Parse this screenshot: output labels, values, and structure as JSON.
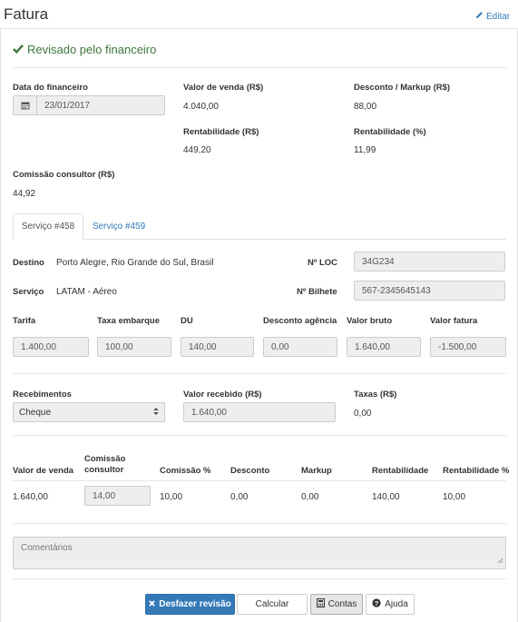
{
  "header": {
    "title": "Fatura",
    "edit_label": "Editar"
  },
  "status": {
    "text": "Revisado pelo financeiro",
    "color": "#3c763d"
  },
  "summary": {
    "date_label": "Data do financeiro",
    "date_value": "23/01/2017",
    "sale_label": "Valor de venda (R$)",
    "sale_value": "4.040,00",
    "discount_label": "Desconto / Markup (R$)",
    "discount_value": "88,00",
    "profit_label": "Rentabilidade (R$)",
    "profit_value": "449,20",
    "profit_pct_label": "Rentabilidade (%)",
    "profit_pct_value": "11,99",
    "commission_label": "Comissão consultor (R$)",
    "commission_value": "44,92"
  },
  "tabs": [
    {
      "label": "Serviço #458",
      "active": true
    },
    {
      "label": "Serviço #459",
      "active": false
    }
  ],
  "service": {
    "destination_label": "Destino",
    "destination_value": "Porto Alegre, Rio Grande do Sul, Brasil",
    "loc_label": "Nº LOC",
    "loc_value": "34G234",
    "service_label": "Serviço",
    "service_value": "LATAM - Aéreo",
    "ticket_label": "Nº Bilhete",
    "ticket_value": "567-2345645143"
  },
  "fares": {
    "headers": [
      "Tarifa",
      "Taxa embarque",
      "DU",
      "Desconto agência",
      "Valor bruto",
      "Valor fatura"
    ],
    "values": [
      "1.400,00",
      "100,00",
      "140,00",
      "0,00",
      "1.640,00",
      "-1.500,00"
    ]
  },
  "receipts": {
    "method_label": "Recebimentos",
    "method_value": "Cheque",
    "received_label": "Valor recebido (R$)",
    "received_value": "1.640,00",
    "taxes_label": "Taxas (R$)",
    "taxes_value": "0,00"
  },
  "breakdown": {
    "headers": [
      "Valor de venda",
      "Comissão consultor",
      "Comissão %",
      "Desconto",
      "Markup",
      "Rentabilidade",
      "Rentabilidade %"
    ],
    "values": [
      "1.640,00",
      "14,00",
      "10,00",
      "0,00",
      "0,00",
      "140,00",
      "10,00"
    ]
  },
  "comments": {
    "placeholder": "Comentários"
  },
  "actions": {
    "undo_label": "Desfazer revisão",
    "calc_label": "Calcular",
    "accounts_label": "Contas",
    "help_label": "Ajuda"
  },
  "colors": {
    "primary": "#337ab7",
    "success": "#3c763d",
    "input_bg": "#eeeeee"
  }
}
